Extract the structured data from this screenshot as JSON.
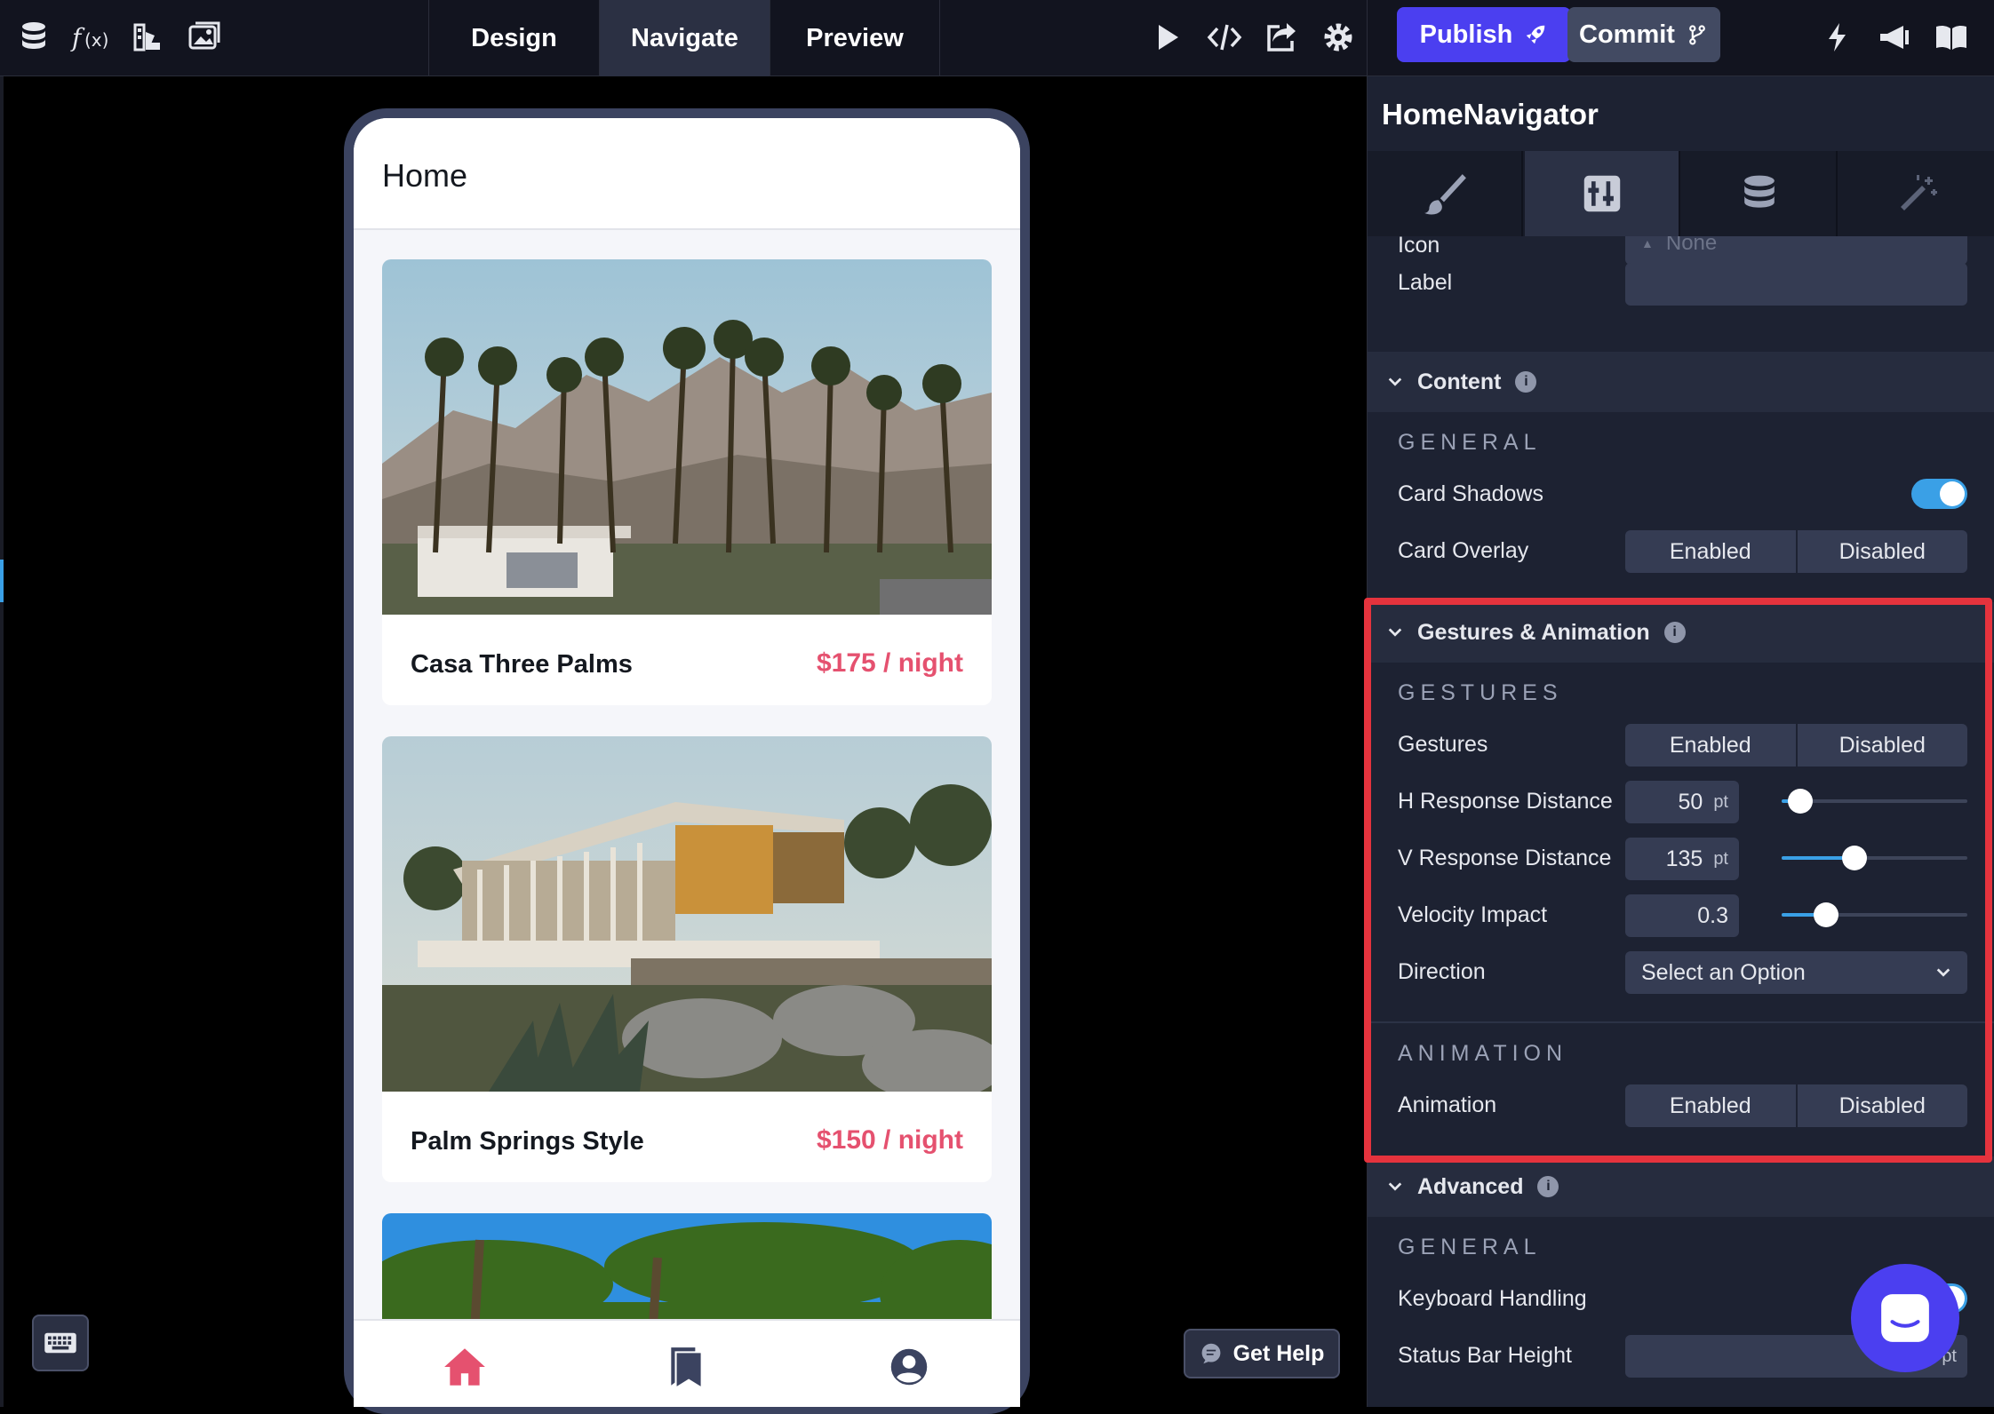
{
  "toolbar": {
    "icons": [
      "database-icon",
      "function-icon",
      "theme-icon",
      "media-icon"
    ],
    "modes": [
      "Design",
      "Navigate",
      "Preview"
    ],
    "active_mode": "Navigate",
    "right_icons": [
      "play-icon",
      "code-icon",
      "share-icon",
      "settings-icon"
    ]
  },
  "actions": {
    "publish_label": "Publish",
    "commit_label": "Commit",
    "extra_icons": [
      "bolt-icon",
      "announcement-icon",
      "docs-icon"
    ]
  },
  "app": {
    "title": "Home",
    "cards": [
      {
        "name": "Casa Three Palms",
        "price": "$175 / night"
      },
      {
        "name": "Palm Springs Style",
        "price": "$150 / night"
      }
    ],
    "nav": [
      "home-icon",
      "bookmarks-icon",
      "profile-icon"
    ]
  },
  "help": {
    "label": "Get Help"
  },
  "panel": {
    "title": "HomeNavigator",
    "tabs": [
      "style-tab",
      "properties-tab",
      "data-tab",
      "magic-tab"
    ],
    "icon_label": "Icon",
    "icon_value": "None",
    "label_label": "Label",
    "label_value": "",
    "content": {
      "title": "Content",
      "group": "GENERAL",
      "card_shadows_label": "Card Shadows",
      "card_shadows_on": true,
      "card_overlay_label": "Card Overlay",
      "enabled": "Enabled",
      "disabled": "Disabled"
    },
    "gestures": {
      "title": "Gestures & Animation",
      "group": "GESTURES",
      "gestures_label": "Gestures",
      "enabled": "Enabled",
      "disabled": "Disabled",
      "h_label": "H Response Distance",
      "h_value": "50",
      "h_unit": "pt",
      "h_fraction": 0.1,
      "v_label": "V Response Distance",
      "v_value": "135",
      "v_unit": "pt",
      "v_fraction": 0.39,
      "velocity_label": "Velocity Impact",
      "velocity_value": "0.3",
      "velocity_fraction": 0.24,
      "direction_label": "Direction",
      "direction_value": "Select an Option",
      "animation_group": "ANIMATION",
      "animation_label": "Animation"
    },
    "advanced": {
      "title": "Advanced",
      "group": "GENERAL",
      "keyboard_label": "Keyboard Handling",
      "status_bar_label": "Status Bar Height",
      "status_bar_unit": "pt"
    }
  },
  "colors": {
    "accent": "#4b3ff0",
    "toggle": "#3aa0e6",
    "price": "#e5516f",
    "highlight": "#e5333d"
  }
}
